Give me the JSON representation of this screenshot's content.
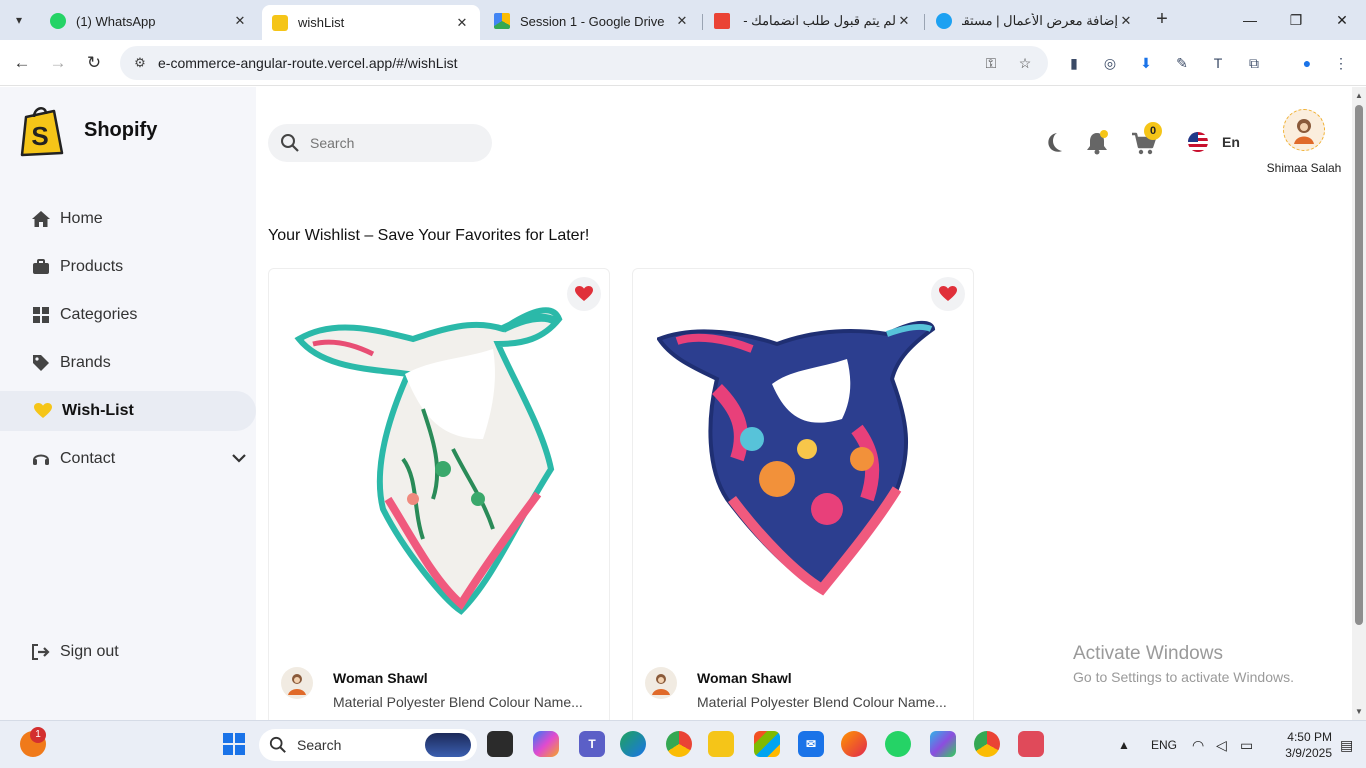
{
  "browser": {
    "tabs": [
      {
        "title": "(1) WhatsApp",
        "icon": "whatsapp-icon",
        "active": false
      },
      {
        "title": "wishList",
        "icon": "shopify-icon",
        "active": true
      },
      {
        "title": "Session 1 - Google Drive",
        "icon": "google-drive-icon",
        "active": false
      },
      {
        "title": "لم يتم قبول طلب انضمامك -",
        "icon": "gmail-icon",
        "active": false
      },
      {
        "title": "إضافة معرض الأعمال | مستقل",
        "icon": "mostaql-icon",
        "active": false
      }
    ],
    "url": "e-commerce-angular-route.vercel.app/#/wishList"
  },
  "sidebar": {
    "brand": "Shopify",
    "items": [
      {
        "label": "Home",
        "icon": "home-icon"
      },
      {
        "label": "Products",
        "icon": "briefcase-icon"
      },
      {
        "label": "Categories",
        "icon": "grid-icon"
      },
      {
        "label": "Brands",
        "icon": "tag-icon"
      },
      {
        "label": "Wish-List",
        "icon": "heart-icon"
      },
      {
        "label": "Contact",
        "icon": "headset-icon"
      }
    ],
    "signout": "Sign out"
  },
  "header": {
    "search_placeholder": "Search",
    "cart_count": "0",
    "language": "En",
    "user_name": "Shimaa Salah"
  },
  "main": {
    "heading": "Your Wishlist – Save Your Favorites for Later!",
    "products": [
      {
        "name": "Woman Shawl",
        "description": "Material Polyester Blend Colour Name..."
      },
      {
        "name": "Woman Shawl",
        "description": "Material Polyester Blend Colour Name..."
      }
    ]
  },
  "watermark": {
    "line1": "Activate Windows",
    "line2": "Go to Settings to activate Windows."
  },
  "taskbar": {
    "search": "Search",
    "notification_count": "1",
    "language": "ENG",
    "time": "4:50 PM",
    "date": "3/9/2025"
  },
  "colors": {
    "accent": "#f5c518",
    "heart": "#e0303a",
    "sidebar_bg": "#f5f6fa"
  }
}
